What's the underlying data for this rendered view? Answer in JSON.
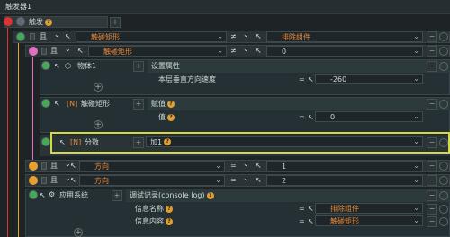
{
  "window": {
    "title": "触发器1"
  },
  "trigger": {
    "label": "触发"
  },
  "rows": {
    "c1": {
      "keyword": "且",
      "operand_a": "触碰矩形",
      "operator": "≠",
      "operand_b": "排除组件"
    },
    "c2": {
      "keyword": "且",
      "operand_a": "触碰矩形",
      "operator": "≠",
      "operand_b": "0"
    },
    "obj1": {
      "name": "物体1",
      "action": "设置属性",
      "param_label": "本层垂直方向速度",
      "operator": "=",
      "value": "-260"
    },
    "rect": {
      "tag": "[N]",
      "name": "触碰矩形",
      "action": "赋值",
      "param_label": "值",
      "operator": "=",
      "value": "0"
    },
    "score": {
      "tag": "[N]",
      "name": "分数",
      "action": "加1"
    },
    "c3": {
      "keyword": "且",
      "operand_a": "方向",
      "operator": "=",
      "operand_b": "1"
    },
    "c4": {
      "keyword": "且",
      "operand_a": "方向",
      "operator": "=",
      "operand_b": "2"
    },
    "sys": {
      "name": "应用系统",
      "action": "调试记录(console log)",
      "p1_label": "信息名称",
      "p1_value": "排除组件",
      "p2_label": "信息内容",
      "p2_value": "触碰矩形",
      "operator": "="
    }
  },
  "icons": {
    "cursor": "↖",
    "chevron": "⌄",
    "add": "+",
    "minus": "−"
  },
  "colors": {
    "accent": "#e88a3a",
    "highlight": "#d4d94a",
    "bg": "#1e2326"
  }
}
